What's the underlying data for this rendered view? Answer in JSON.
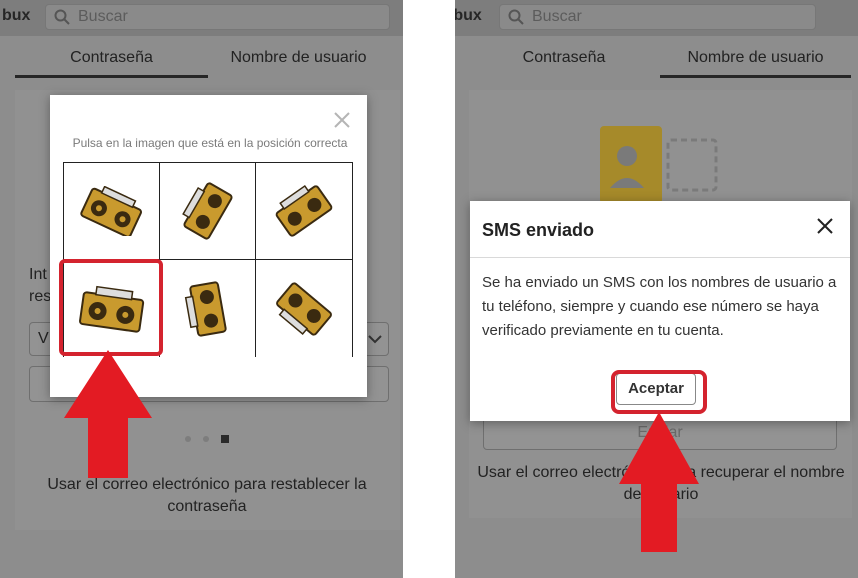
{
  "left": {
    "brand": "bux",
    "search_placeholder": "Buscar",
    "tabs": [
      "Contraseña",
      "Nombre de usuario"
    ],
    "bg_text_1": "Int",
    "bg_text_2": "res",
    "bg_input_char": "V",
    "footer": "Usar el correo electrónico para restablecer la contraseña",
    "captcha": {
      "instruction": "Pulsa en la imagen que está en la posición correcta",
      "pages": 3,
      "current_page": 3,
      "images": [
        "boombox-icon",
        "boombox-icon",
        "boombox-icon",
        "boombox-icon",
        "boombox-icon",
        "boombox-icon"
      ],
      "selected_index": 3
    }
  },
  "right": {
    "brand": "Robux",
    "search_placeholder": "Buscar",
    "tabs": [
      "Contraseña",
      "Nombre de usuario"
    ],
    "bg_button": "Enviar",
    "footer": "Usar el correo electrónico para recuperar el nombre de usuario",
    "dialog": {
      "title": "SMS enviado",
      "body": "Se ha enviado un SMS con los nombres de usuario a tu teléfono, siempre y cuando ese número se haya verificado previamente en tu cuenta.",
      "accept": "Aceptar"
    }
  },
  "colors": {
    "highlight": "#d4232e",
    "arrow": "#e31b23"
  }
}
